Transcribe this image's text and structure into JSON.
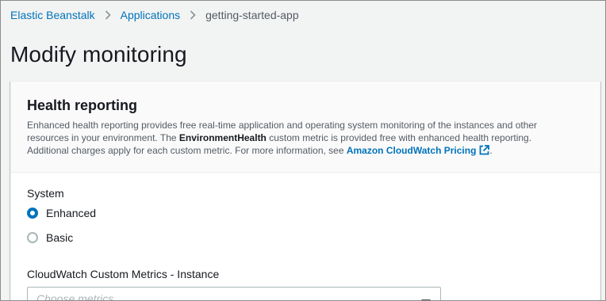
{
  "breadcrumb": {
    "items": [
      {
        "label": "Elastic Beanstalk"
      },
      {
        "label": "Applications"
      },
      {
        "label": "getting-started-app"
      }
    ]
  },
  "page": {
    "title": "Modify monitoring"
  },
  "health_reporting": {
    "title": "Health reporting",
    "desc_part1": "Enhanced health reporting provides free real-time application and operating system monitoring of the instances and other resources in your environment. The ",
    "desc_bold": "EnvironmentHealth",
    "desc_part2": " custom metric is provided free with enhanced health reporting. Additional charges apply for each custom metric. For more information, see ",
    "desc_link": "Amazon CloudWatch Pricing",
    "desc_end": ".",
    "system_label": "System",
    "options": [
      {
        "label": "Enhanced",
        "checked": true
      },
      {
        "label": "Basic",
        "checked": false
      }
    ],
    "metrics_label": "CloudWatch Custom Metrics - Instance",
    "metrics_placeholder": "Choose metrics"
  },
  "colors": {
    "link": "#0073bb",
    "radio_selected": "#0073bb",
    "page_bg": "#f2f3f3",
    "header_bg": "#fafafa"
  },
  "icons": [
    "chevron-right-icon",
    "external-link-icon",
    "caret-down-icon"
  ]
}
